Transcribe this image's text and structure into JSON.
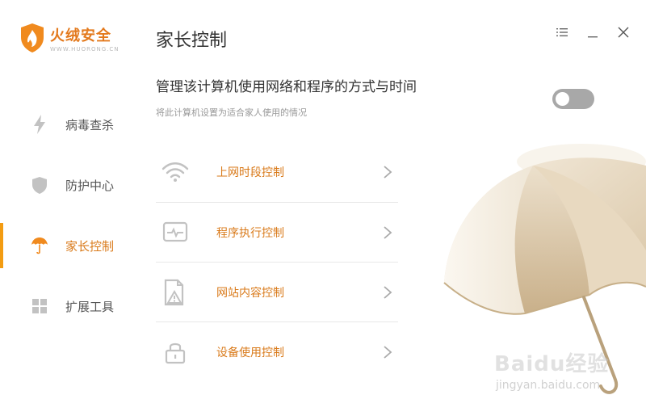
{
  "app": {
    "name": "火绒安全",
    "url": "WWW.HUORONG.CN"
  },
  "sidebar": {
    "items": [
      {
        "label": "病毒查杀",
        "icon": "lightning-icon",
        "active": false
      },
      {
        "label": "防护中心",
        "icon": "shield-icon",
        "active": false
      },
      {
        "label": "家长控制",
        "icon": "umbrella-icon",
        "active": true
      },
      {
        "label": "扩展工具",
        "icon": "grid-icon",
        "active": false
      }
    ]
  },
  "window_controls": [
    "menu-icon",
    "minimize-icon",
    "close-icon"
  ],
  "main": {
    "title": "家长控制",
    "subtitle": "管理该计算机使用网络和程序的方式与时间",
    "hint": "将此计算机设置为适合家人使用的情况",
    "toggle": {
      "on": false
    },
    "controls": [
      {
        "label": "上网时段控制",
        "icon": "wifi-icon"
      },
      {
        "label": "程序执行控制",
        "icon": "program-monitor-icon"
      },
      {
        "label": "网站内容控制",
        "icon": "web-document-icon"
      },
      {
        "label": "设备使用控制",
        "icon": "lock-icon"
      }
    ]
  },
  "watermark": {
    "main": "Baidu经验",
    "sub": "jingyan.baidu.com"
  },
  "colors": {
    "accent": "#d97a1a",
    "active_bar": "#f39c12",
    "toggle_off": "#a8a8a8",
    "text_primary": "#333333",
    "text_hint": "#999999",
    "icon_gray": "#c2c2c2"
  }
}
